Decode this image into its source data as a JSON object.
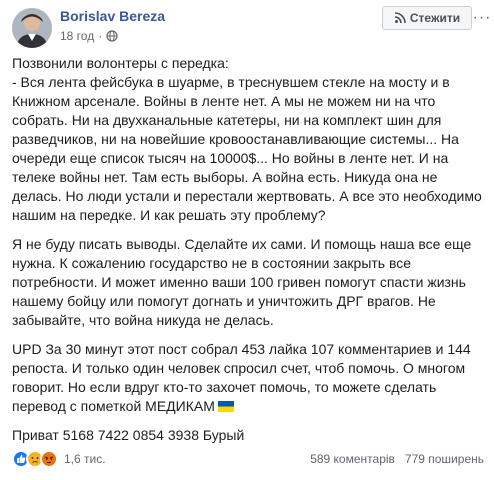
{
  "post": {
    "author": "Borislav Bereza",
    "time": "18 год",
    "privacy_icon": "globe-icon",
    "follow_button": {
      "label": "Стежити",
      "icon": "rss-icon"
    },
    "more_icon": "more-options-icon",
    "paragraphs": [
      "Позвонили волонтеры с передка:\n- Вся лента фейсбука в шуарме, в треснувшем стекле на мосту и в Книжном арсенале. Войны в ленте нет. А мы не можем ни на что собрать. Ни на двухканальные катетеры, ни на комплект шин для разведчиков, ни на новейшие кровоостанавливающие системы... На очереди еще список тысяч на 10000$... Но войны в ленте нет. И на телеке войны нет. Там есть выборы. А война есть. Никуда она не делась. Но люди устали и перестали жертвовать. А все это необходимо нашим на передке. И как решать эту проблему?",
      "Я не буду писать выводы. Сделайте их сами. И помощь наша все еще нужна. К сожалению государство не в состоянии закрыть все потребности. И может именно ваши 100 гривен помогут спасти жизнь нашему бойцу или помогут догнать и уничтожить ДРГ врагов. Не забывайте, что война никуда не делась.",
      "UPD За 30 минут этот пост собрал 453 лайка 107 комментариев и 144 репоста. И только один человек спросил счет, чтоб помочь. О многом говорит. Но если вдруг кто-то захочет помочь, то можете сделать перевод с пометкой МЕДИКАМ",
      "Приват 5168 7422 0854 3938 Бурый"
    ],
    "flag_icon": "ukraine-flag-icon"
  },
  "footer": {
    "reactions": [
      "like-icon",
      "sad-icon",
      "angry-icon"
    ],
    "reaction_count": "1,6 тис.",
    "comments": "589 коментарів",
    "shares": "779 поширень"
  },
  "colors": {
    "link": "#385898",
    "like": "#1877f2",
    "sad": "#f7b125",
    "angry": "#e9710f",
    "flag_blue": "#0057b7",
    "flag_yellow": "#ffd700"
  }
}
